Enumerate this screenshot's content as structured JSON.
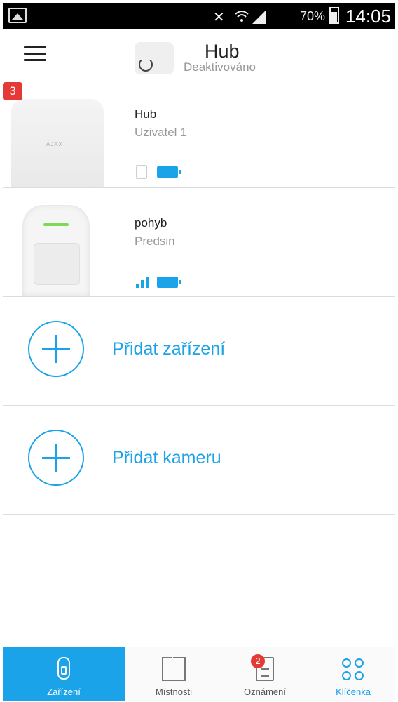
{
  "status_bar": {
    "battery": "70%",
    "time": "14:05"
  },
  "header": {
    "title": "Hub",
    "status": "Deaktivováno"
  },
  "devices": [
    {
      "badge": "3",
      "name": "Hub",
      "room": "Uzivatel 1"
    },
    {
      "name": "pohyb",
      "room": "Predsin"
    }
  ],
  "hub_brand": "AJAX",
  "actions": {
    "add_device": "Přidat zařízení",
    "add_camera": "Přidat kameru"
  },
  "bottom_nav": {
    "devices": "Zařízení",
    "rooms": "Místnosti",
    "notifications": "Oznámení",
    "notifications_badge": "2",
    "keyfob": "Klíčenka"
  },
  "colors": {
    "accent": "#1aa3e8",
    "badge": "#e53935"
  }
}
